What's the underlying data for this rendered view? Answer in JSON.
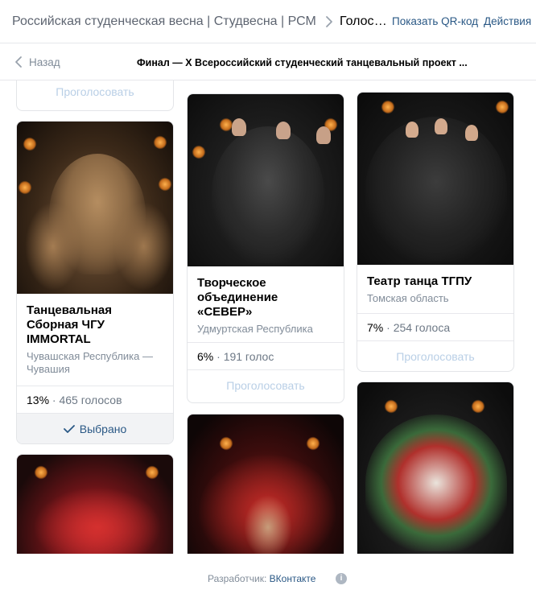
{
  "header": {
    "root": "Российская студенческая весна | Студвесна | РСМ",
    "current": "Голосование",
    "qr_link": "Показать QR-код",
    "actions_link": "Действия"
  },
  "subheader": {
    "back_label": "Назад",
    "title": "Финал — X Всероссийский студенческий танцевальный проект ..."
  },
  "vote_label": "Проголосовать",
  "chosen_label": "Выбрано",
  "cards": [
    {
      "name": "Танцевальная Сборная ЧГУ IMMORTAL",
      "region": "Чувашская Республика — Чувашия",
      "percent": "13%",
      "votes": "465 голосов",
      "button": "Выбрано",
      "photo_tone": "#8a6a48"
    },
    {
      "name": "Творческое объединение «СЕВЕР»",
      "region": "Удмуртская Республика",
      "percent": "6%",
      "votes": "191 голос",
      "button": "Проголосовать",
      "photo_tone": "#1e1e1e"
    },
    {
      "name": "Театр танца ТГПУ",
      "region": "Томская область",
      "percent": "7%",
      "votes": "254 голоса",
      "button": "Проголосовать",
      "photo_tone": "#1c1c1c"
    }
  ],
  "footer": {
    "prefix": "Разработчик:",
    "developer": "ВКонтакте"
  },
  "colors": {
    "link": "#2a5885",
    "muted": "#818c99",
    "vote_disabled": "#b9cfe6",
    "border": "#e3e5e8"
  }
}
